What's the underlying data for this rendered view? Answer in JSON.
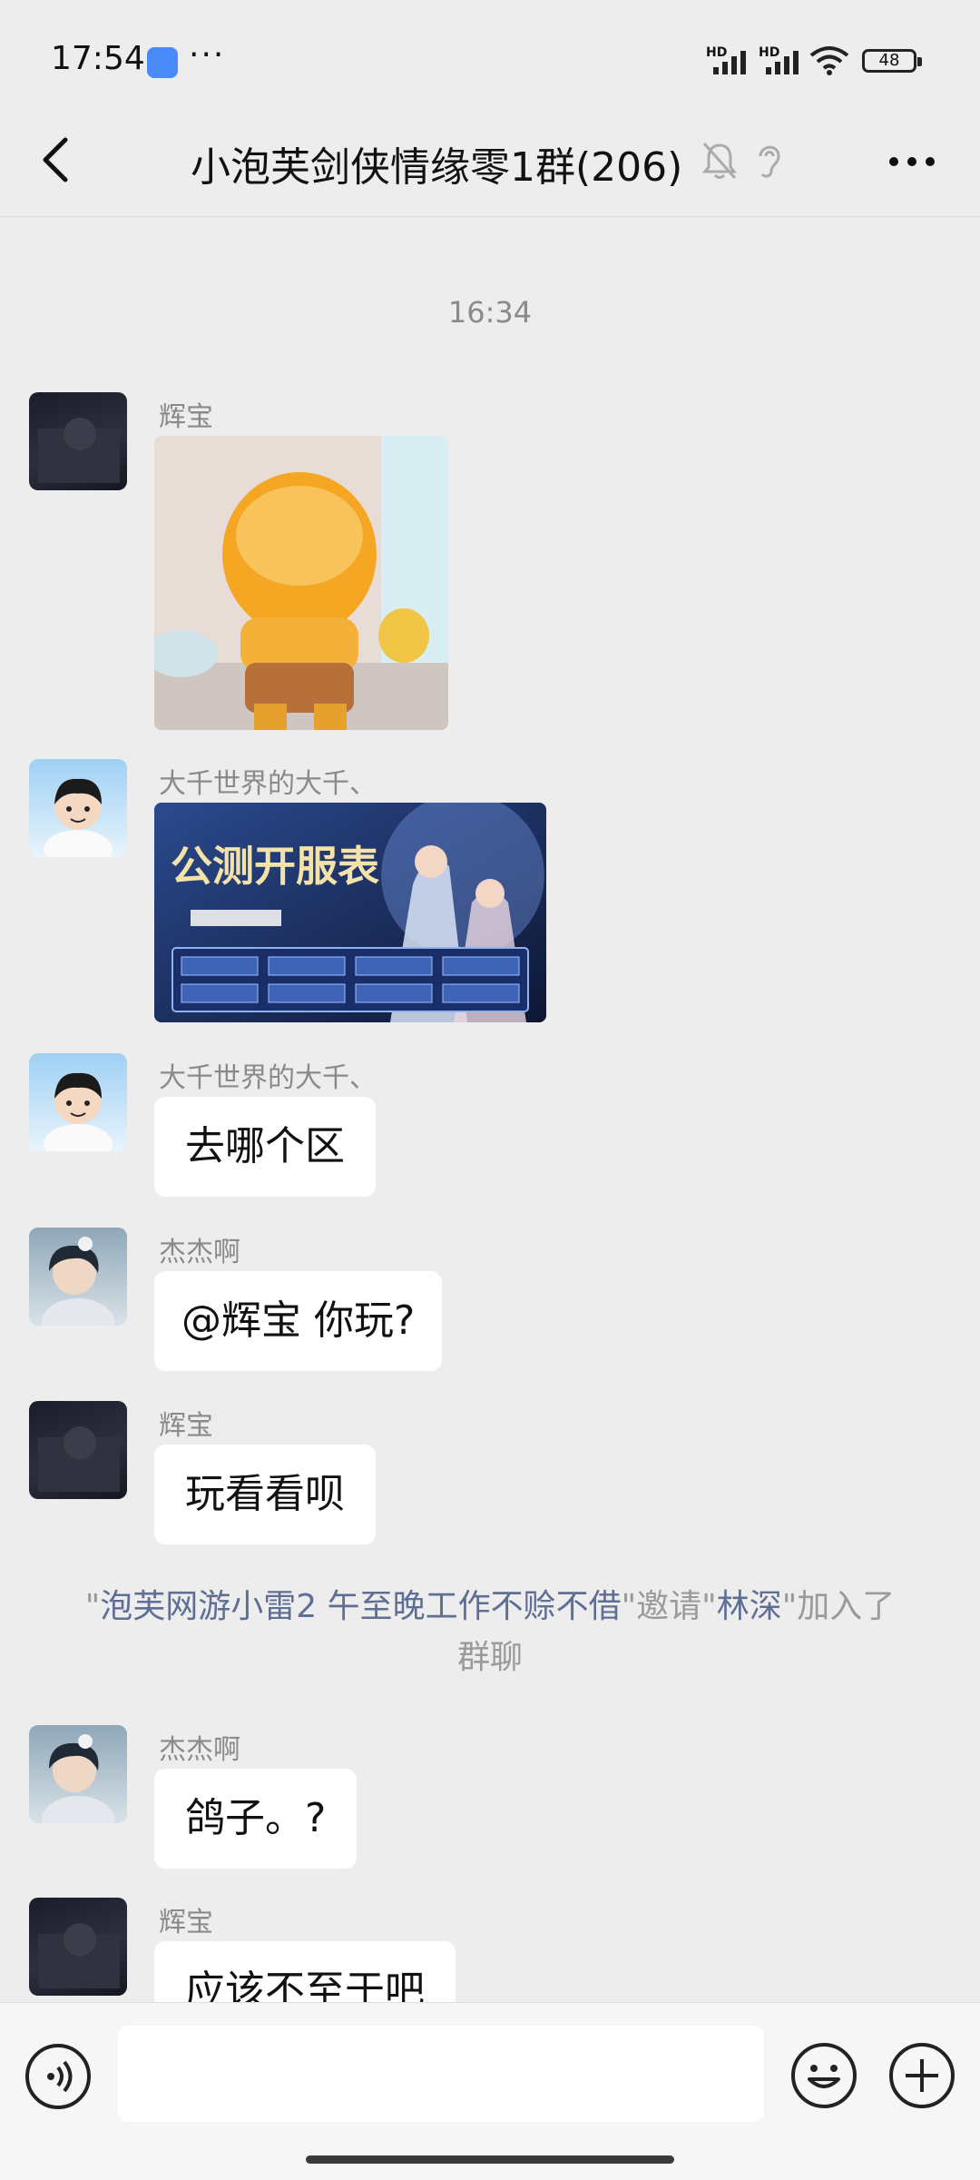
{
  "status_bar": {
    "time": "17:54",
    "dots": "···",
    "hd1": "HD",
    "hd2": "HD",
    "battery": "48"
  },
  "header": {
    "title": "小泡芙剑侠情缘零1群(206)"
  },
  "chat": {
    "timestamp": "16:34",
    "messages": [
      {
        "sender": "辉宝",
        "type": "image",
        "image": "yellow-bear-sticker"
      },
      {
        "sender": "大千世界的大千、",
        "type": "image",
        "image": "game-schedule-poster",
        "image_text": "公测开服表"
      },
      {
        "sender": "大千世界的大千、",
        "type": "text",
        "text": "去哪个区"
      },
      {
        "sender": "杰杰啊",
        "type": "text",
        "text": "@辉宝  你玩?"
      },
      {
        "sender": "辉宝",
        "type": "text",
        "text": "玩看看呗"
      },
      {
        "sender": "杰杰啊",
        "type": "text",
        "text": "鸽子。?"
      },
      {
        "sender": "辉宝",
        "type": "text",
        "text": "应该不至于吧"
      }
    ],
    "system": {
      "q1": "\"",
      "inviter": "泡芙网游小雷2 午至晚工作不赊不借",
      "q2": "\"邀请\"",
      "invitee": "林深",
      "q3": "\"加入了群聊"
    }
  },
  "colors": {
    "background": "#ededed",
    "bubble": "#ffffff",
    "name_link": "#5f6e94",
    "muted_text": "#8a8a8a"
  },
  "icons": [
    "back-icon",
    "mute-bell-icon",
    "ear-icon",
    "more-icon",
    "voice-icon",
    "emoji-icon",
    "add-icon"
  ]
}
